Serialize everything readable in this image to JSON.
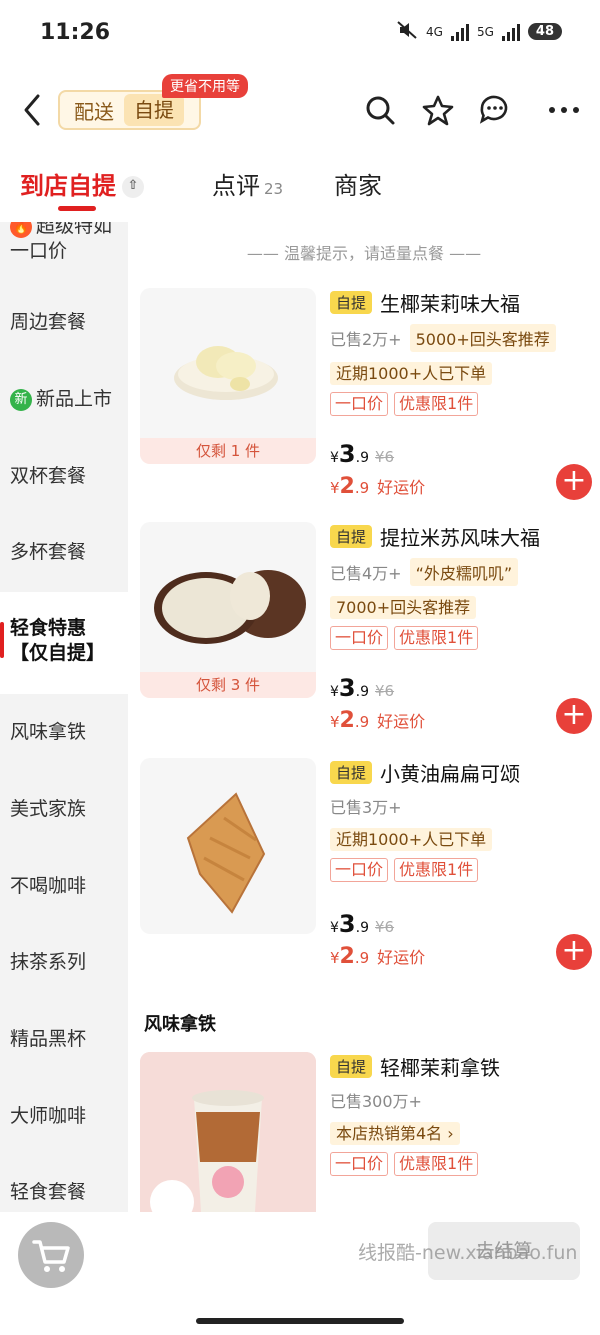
{
  "status_bar": {
    "time": "11:26",
    "net1": "4G",
    "net2": "5G",
    "battery": "48"
  },
  "nav": {
    "delivery_label": "配送",
    "pickup_label": "自提",
    "promo_tag": "更省不用等"
  },
  "tabs": [
    {
      "label": "到店自提"
    },
    {
      "label": "点评",
      "count": "23"
    },
    {
      "label": "商家"
    }
  ],
  "sidebar": {
    "items": [
      {
        "label": "超级特如",
        "sub": "一口价"
      },
      {
        "label": "周边套餐"
      },
      {
        "label": "新品上市",
        "badge": "新"
      },
      {
        "label": "双杯套餐"
      },
      {
        "label": "多杯套餐"
      },
      {
        "label": "轻食特惠",
        "sub": "【仅自提】"
      },
      {
        "label": "风味拿铁"
      },
      {
        "label": "美式家族"
      },
      {
        "label": "不喝咖啡"
      },
      {
        "label": "抹茶系列"
      },
      {
        "label": "精品黑杯"
      },
      {
        "label": "大师咖啡"
      },
      {
        "label": "轻食套餐"
      }
    ]
  },
  "content": {
    "hint": "—— 温馨提示，请适量点餐 ——",
    "section_title": "风味拿铁",
    "self_tag": "自提",
    "products": [
      {
        "name": "生椰茉莉味大福",
        "sold": "已售2万+",
        "rec_inline": "5000+回头客推荐",
        "rec_line": "近期1000+人已下单",
        "tags": [
          "一口价",
          "优惠限1件"
        ],
        "stock": "仅剩 1 件",
        "price_symbol": "¥",
        "price_int": "3",
        "price_dec": ".9",
        "old_price": "¥6",
        "deal_symbol": "¥",
        "deal_int": "2",
        "deal_dec": ".9",
        "deal_label": "好运价"
      },
      {
        "name": "提拉米苏风味大福",
        "sold": "已售4万+",
        "rec_inline": "“外皮糯叽叽”",
        "rec_line": "7000+回头客推荐",
        "tags": [
          "一口价",
          "优惠限1件"
        ],
        "stock": "仅剩 3 件",
        "price_symbol": "¥",
        "price_int": "3",
        "price_dec": ".9",
        "old_price": "¥6",
        "deal_symbol": "¥",
        "deal_int": "2",
        "deal_dec": ".9",
        "deal_label": "好运价"
      },
      {
        "name": "小黄油扁扁可颂",
        "sold": "已售3万+",
        "rec_inline": "",
        "rec_line": "近期1000+人已下单",
        "tags": [
          "一口价",
          "优惠限1件"
        ],
        "stock": "",
        "price_symbol": "¥",
        "price_int": "3",
        "price_dec": ".9",
        "old_price": "¥6",
        "deal_symbol": "¥",
        "deal_int": "2",
        "deal_dec": ".9",
        "deal_label": "好运价"
      },
      {
        "name": "轻椰茉莉拿铁",
        "sold": "已售300万+",
        "rec_inline": "",
        "rec_line": "本店热销第4名 ›",
        "tags": [
          "一口价",
          "优惠限1件"
        ],
        "stock": ""
      }
    ]
  },
  "bottom": {
    "checkout_label": "去结算",
    "watermark": "线报酷-new.xianbao.fun"
  },
  "colors": {
    "accent": "#e02020",
    "add_button": "#e8403a",
    "pickup_tag": "#f8d74d"
  }
}
